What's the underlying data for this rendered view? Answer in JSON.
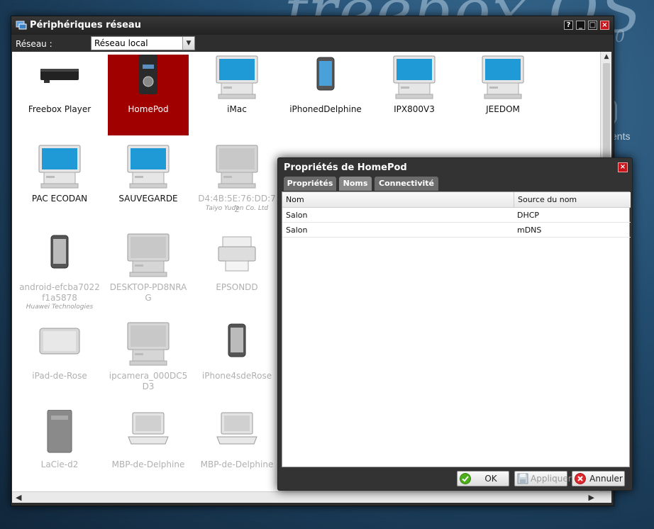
{
  "desktop": {
    "logo": "freebox OS",
    "version_digit": "0",
    "side_text": "ents"
  },
  "window": {
    "title": "Périphériques réseau",
    "buttons": [
      "?",
      "_",
      "□",
      "×"
    ],
    "network_label": "Réseau :",
    "network_value": "Réseau local"
  },
  "devices": [
    {
      "name": "Freebox Player",
      "icon": "freebox-player-icon",
      "selected": false,
      "dim": false
    },
    {
      "name": "HomePod",
      "icon": "homepod-icon",
      "selected": true,
      "dim": false
    },
    {
      "name": "iMac",
      "icon": "monitor-icon",
      "selected": false,
      "dim": false
    },
    {
      "name": "iPhonedDelphine",
      "icon": "phone-icon",
      "selected": false,
      "dim": false
    },
    {
      "name": "IPX800V3",
      "icon": "monitor-icon",
      "selected": false,
      "dim": false
    },
    {
      "name": "JEEDOM",
      "icon": "monitor-icon",
      "selected": false,
      "dim": false
    },
    {
      "name": "PAC ECODAN",
      "icon": "monitor-icon",
      "selected": false,
      "dim": false
    },
    {
      "name": "SAUVEGARDE",
      "icon": "monitor-icon",
      "selected": false,
      "dim": false
    },
    {
      "name": "D4:4B:5E:76:DD:72",
      "sub": "Taiyo Yuden Co. Ltd",
      "icon": "monitor-icon",
      "selected": false,
      "dim": true
    },
    {
      "name": "android-efcba7022f1a5878",
      "sub": "Huawei Technologies",
      "icon": "phone-icon",
      "selected": false,
      "dim": true
    },
    {
      "name": "DESKTOP-PD8NRAG",
      "icon": "monitor-icon",
      "selected": false,
      "dim": true
    },
    {
      "name": "EPSONDD",
      "icon": "printer-icon",
      "selected": false,
      "dim": true
    },
    {
      "name": "iPad-de-Rose",
      "icon": "tablet-icon",
      "selected": false,
      "dim": true
    },
    {
      "name": "ipcamera_000DC5D3",
      "icon": "monitor-icon",
      "selected": false,
      "dim": true
    },
    {
      "name": "iPhone4sdeRose",
      "icon": "phone-icon",
      "selected": false,
      "dim": true
    },
    {
      "name": "LaCie-d2",
      "icon": "nas-icon",
      "selected": false,
      "dim": true
    },
    {
      "name": "MBP-de-Delphine",
      "icon": "laptop-icon",
      "selected": false,
      "dim": true
    },
    {
      "name": "MBP-de-Delphine",
      "icon": "laptop-icon",
      "selected": false,
      "dim": true
    }
  ],
  "dialog": {
    "title": "Propriétés de HomePod",
    "tabs": [
      {
        "label": "Propriétés",
        "active": false
      },
      {
        "label": "Noms",
        "active": true
      },
      {
        "label": "Connectivité",
        "active": false
      }
    ],
    "columns": [
      "Nom",
      "Source du nom"
    ],
    "rows": [
      [
        "Salon",
        "DHCP"
      ],
      [
        "Salon",
        "mDNS"
      ]
    ],
    "buttons": {
      "ok": "OK",
      "apply": "Appliquer",
      "cancel": "Annuler"
    }
  },
  "colors": {
    "selection": "#a00000",
    "close": "#c8141a"
  }
}
